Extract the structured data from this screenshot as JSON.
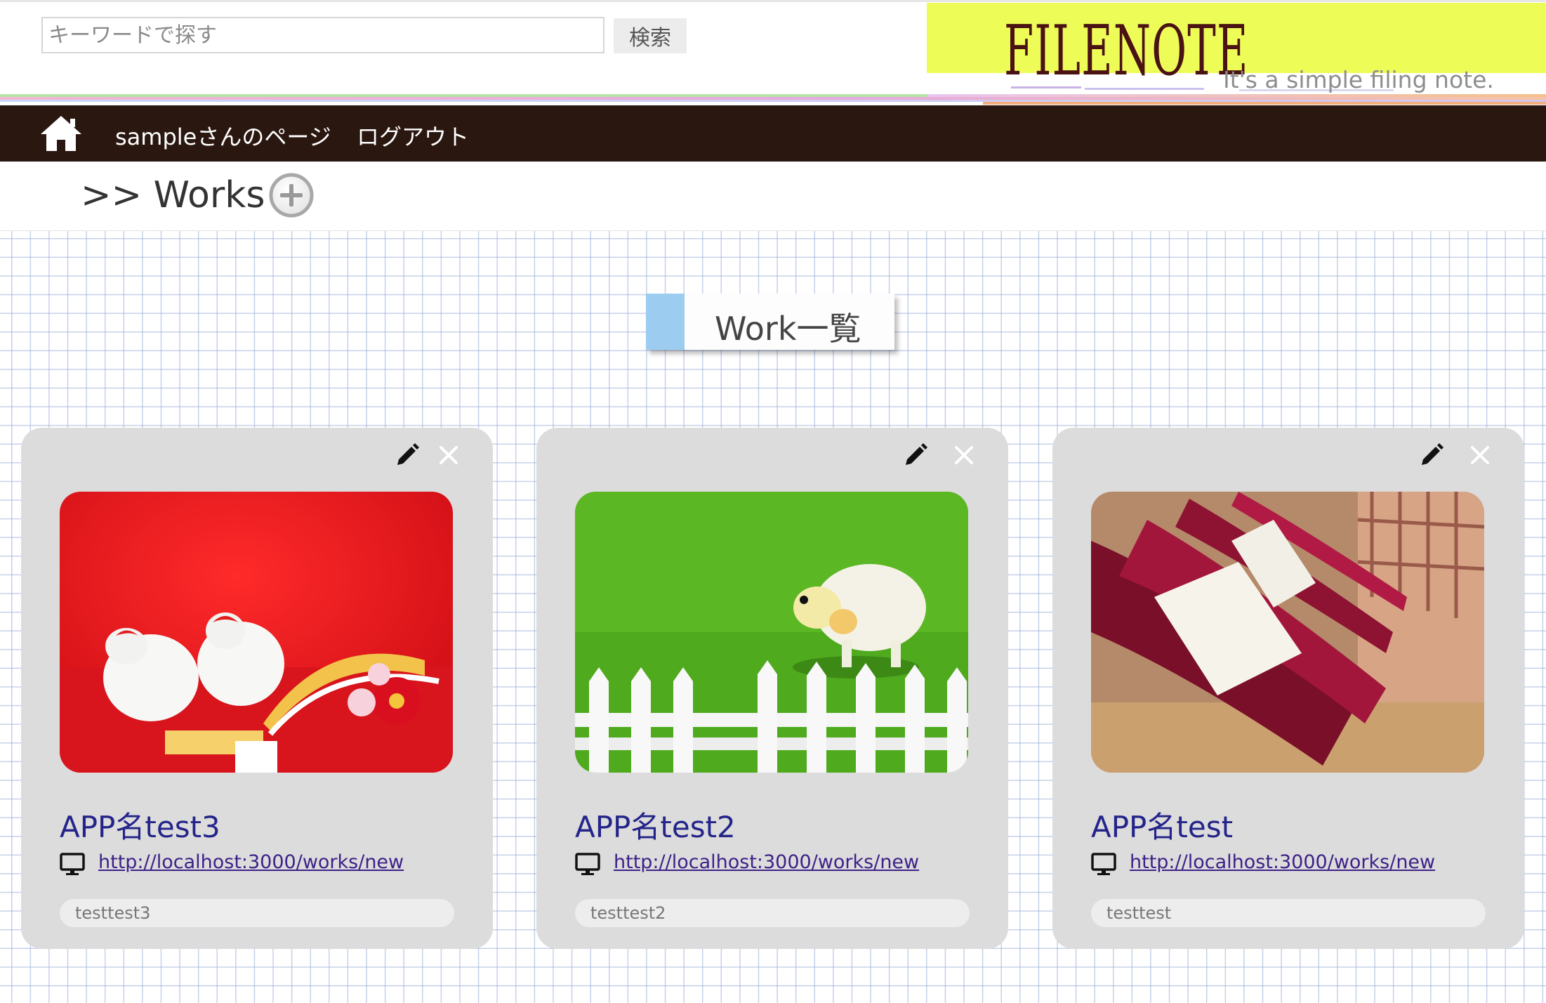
{
  "search": {
    "placeholder": "キーワードで探す",
    "button_label": "検索"
  },
  "brand": {
    "logo": "FILENOTE",
    "tagline": "It's a simple filing note.",
    "logo_bg_color": "#eefc58"
  },
  "nav": {
    "home_icon": "home-icon",
    "user_page_label": "sampleさんのページ",
    "logout_label": "ログアウト",
    "bg_color": "#2a1710"
  },
  "page": {
    "title": ">> Works",
    "add_icon": "plus-circle-icon",
    "section_label": "Work一覧"
  },
  "cards": [
    {
      "title": "APP名test3",
      "url": "http://localhost:3000/works/new",
      "description": "testtest3",
      "image": "red-new-year-decorations-photo"
    },
    {
      "title": "APP名test2",
      "url": "http://localhost:3000/works/new",
      "description": "testtest2",
      "image": "sheep-figure-on-grass-photo"
    },
    {
      "title": "APP名test",
      "url": "http://localhost:3000/works/new",
      "description": "testtest",
      "image": "wine-bottles-photo"
    }
  ],
  "colors": {
    "card_bg": "#dcdcdc",
    "title_color": "#24248a",
    "link_color": "#3e2188",
    "section_accent": "#9cccf0"
  }
}
